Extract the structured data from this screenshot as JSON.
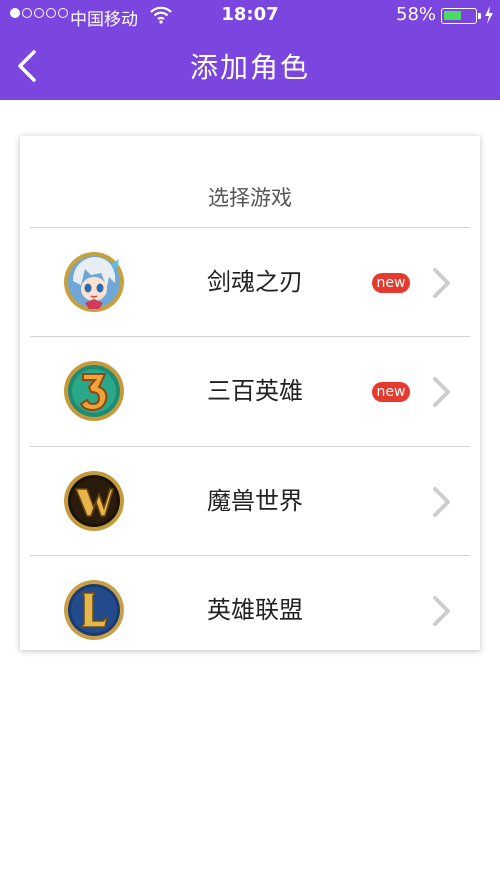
{
  "status_bar": {
    "carrier": "中国移动",
    "time": "18:07",
    "battery_percent": "58%",
    "battery_level": 0.58,
    "signal_bars_filled": 1,
    "signal_bars_total": 5
  },
  "nav": {
    "title": "添加角色",
    "back_icon": "chevron-left-icon"
  },
  "card": {
    "heading": "选择游戏",
    "games": [
      {
        "name": "剑魂之刃",
        "badge": "new",
        "icon": "sword-soul-game-icon"
      },
      {
        "name": "三百英雄",
        "badge": "new",
        "icon": "three-hundred-heroes-game-icon"
      },
      {
        "name": "魔兽世界",
        "badge": "",
        "icon": "world-of-warcraft-game-icon"
      },
      {
        "name": "英雄联盟",
        "badge": "",
        "icon": "league-of-legends-game-icon"
      }
    ]
  },
  "colors": {
    "header_bg": "#7b45e0",
    "badge_bg": "#e53a2e",
    "battery_fill": "#4cd964"
  }
}
